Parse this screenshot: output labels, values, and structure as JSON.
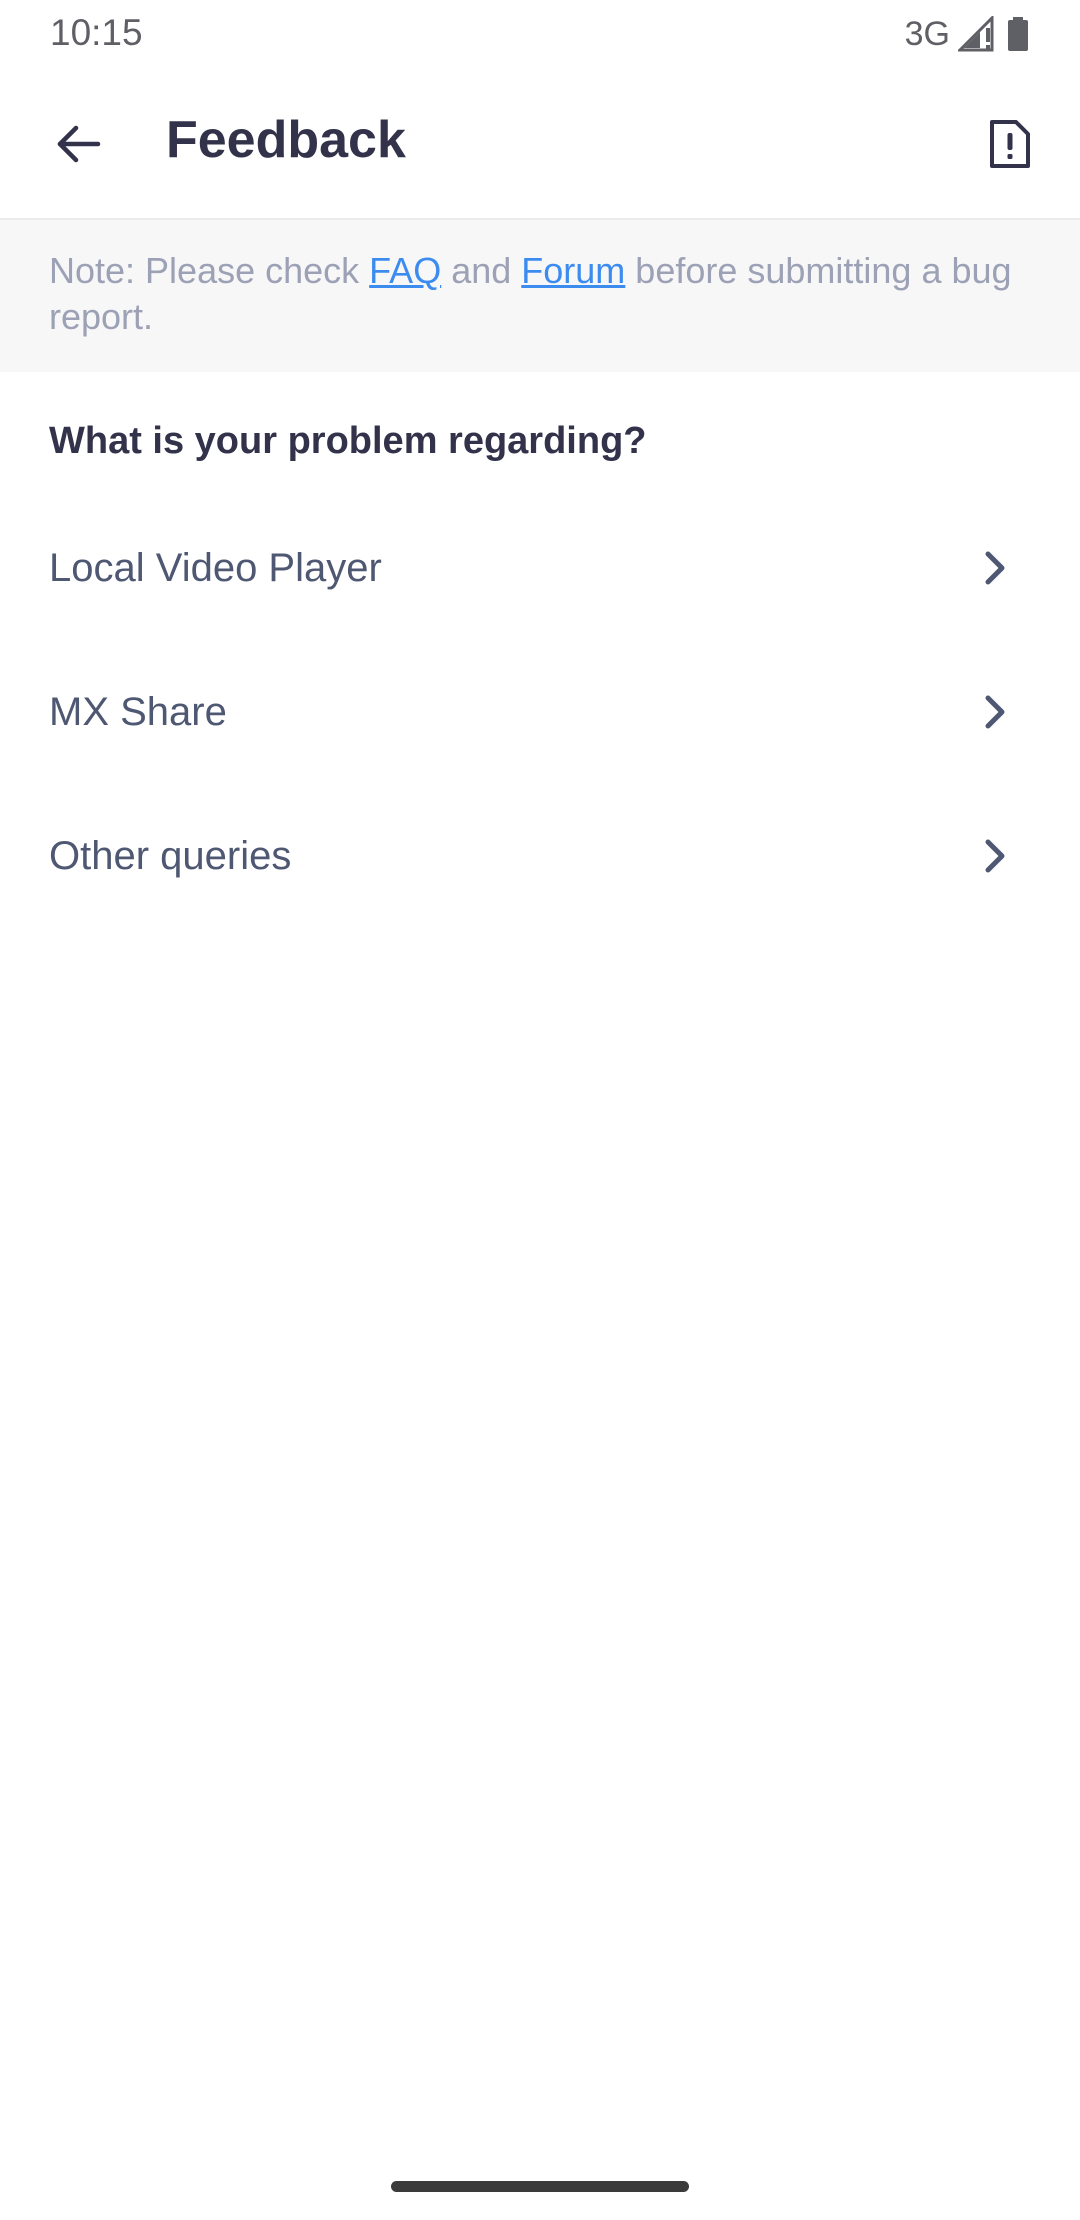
{
  "status_bar": {
    "time": "10:15",
    "network": "3G",
    "signal_icon": "signal-icon",
    "battery_icon": "battery-icon"
  },
  "toolbar": {
    "title": "Feedback",
    "back_icon": "arrow-back-icon",
    "report_icon": "report-document-icon"
  },
  "note": {
    "prefix": "Note: Please check ",
    "faq_link": "FAQ",
    "middle": " and ",
    "forum_link": "Forum",
    "suffix": " before submitting a bug report."
  },
  "question": "What is your problem regarding?",
  "options": [
    {
      "label": "Local Video Player"
    },
    {
      "label": "MX Share"
    },
    {
      "label": "Other queries"
    }
  ],
  "colors": {
    "title": "#33324b",
    "option_text": "#4f5872",
    "link": "#3c8cf0",
    "note_text": "#9ca1b5",
    "note_bg": "#f7f7f8"
  }
}
